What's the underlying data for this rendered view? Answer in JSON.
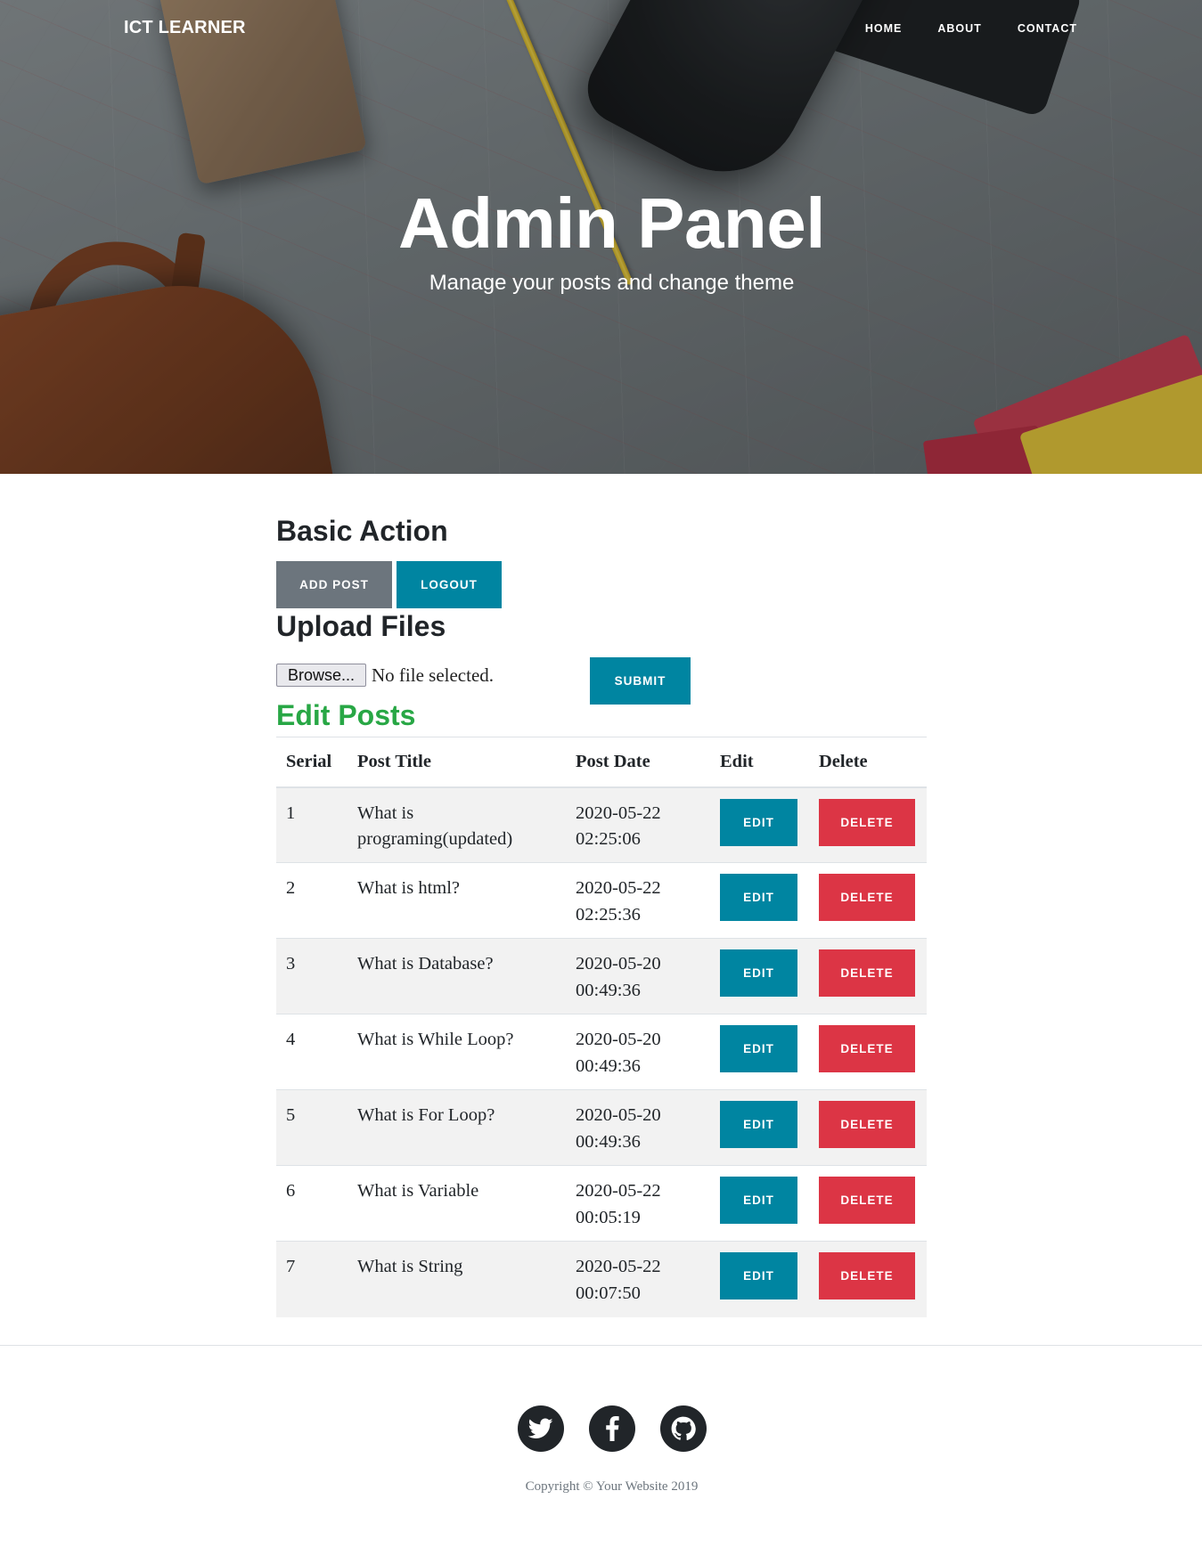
{
  "navbar": {
    "brand": "ICT LEARNER",
    "links": [
      "HOME",
      "ABOUT",
      "CONTACT"
    ]
  },
  "hero": {
    "title": "Admin Panel",
    "subtitle": "Manage your posts and change theme"
  },
  "basic_action": {
    "heading": "Basic Action",
    "add_post_label": "ADD POST",
    "logout_label": "LOGOUT"
  },
  "upload": {
    "heading": "Upload Files",
    "browse_label": "Browse...",
    "file_status": "No file selected.",
    "submit_label": "SUBMIT"
  },
  "edit_posts": {
    "heading": "Edit Posts",
    "columns": [
      "Serial",
      "Post Title",
      "Post Date",
      "Edit",
      "Delete"
    ],
    "edit_label": "EDIT",
    "delete_label": "DELETE",
    "rows": [
      {
        "serial": "1",
        "title": "What is programing(updated)",
        "date": "2020-05-22",
        "time": "02:25:06"
      },
      {
        "serial": "2",
        "title": "What is html?",
        "date": "2020-05-22",
        "time": "02:25:36"
      },
      {
        "serial": "3",
        "title": "What is Database?",
        "date": "2020-05-20",
        "time": "00:49:36"
      },
      {
        "serial": "4",
        "title": "What is While Loop?",
        "date": "2020-05-20",
        "time": "00:49:36"
      },
      {
        "serial": "5",
        "title": "What is For Loop?",
        "date": "2020-05-20",
        "time": "00:49:36"
      },
      {
        "serial": "6",
        "title": "What is Variable",
        "date": "2020-05-22",
        "time": "00:05:19"
      },
      {
        "serial": "7",
        "title": "What is String",
        "date": "2020-05-22",
        "time": "00:07:50"
      }
    ]
  },
  "footer": {
    "social_icons": [
      "twitter-icon",
      "facebook-icon",
      "github-icon"
    ],
    "copyright": "Copyright © Your Website 2019"
  },
  "colors": {
    "teal": "#0085a1",
    "gray": "#6c757d",
    "red": "#dc3545",
    "green": "#28a745",
    "dark": "#212529"
  }
}
